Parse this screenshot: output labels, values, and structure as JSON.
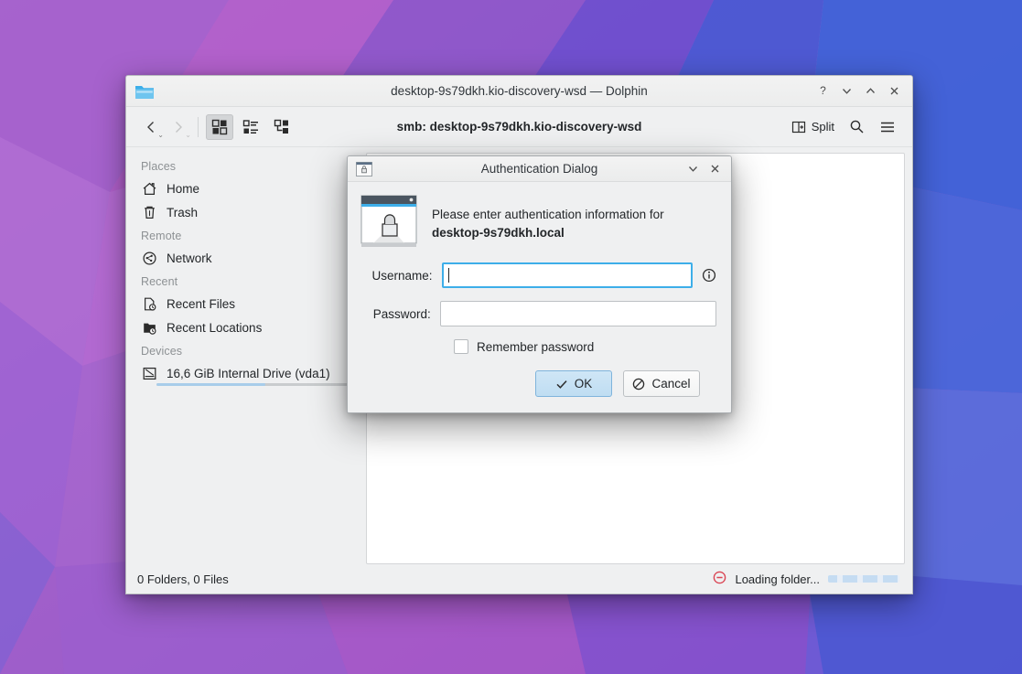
{
  "desktop": {
    "wallpaper_name": "plasma-polygon-wallpaper"
  },
  "window": {
    "title": "desktop-9s79dkh.kio-discovery-wsd — Dolphin",
    "app_icon": "folder-icon",
    "controls": [
      {
        "name": "help-button",
        "glyph": "?"
      },
      {
        "name": "minimize-button",
        "glyph": "⌄"
      },
      {
        "name": "maximize-button",
        "glyph": "⌃"
      },
      {
        "name": "close-button",
        "glyph": "✕"
      }
    ]
  },
  "toolbar": {
    "back_label": "Back",
    "forward_label": "Forward",
    "view_icons_label": "Icons",
    "view_compact_label": "Compact",
    "view_details_label": "Details",
    "url": "smb: desktop-9s79dkh.kio-discovery-wsd",
    "split_label": "Split",
    "search_label": "Search",
    "menu_label": "Menu"
  },
  "sidebar": {
    "groups": [
      {
        "title": "Places",
        "items": [
          {
            "label": "Home",
            "icon": "home-icon"
          },
          {
            "label": "Trash",
            "icon": "trash-icon"
          }
        ]
      },
      {
        "title": "Remote",
        "items": [
          {
            "label": "Network",
            "icon": "network-icon"
          }
        ]
      },
      {
        "title": "Recent",
        "items": [
          {
            "label": "Recent Files",
            "icon": "recent-file-icon"
          },
          {
            "label": "Recent Locations",
            "icon": "recent-folder-icon"
          }
        ]
      },
      {
        "title": "Devices",
        "items": [
          {
            "label": "16,6 GiB Internal Drive (vda1)",
            "icon": "harddisk-icon",
            "capacity_percent": 55
          }
        ]
      }
    ]
  },
  "statusbar": {
    "counts": "0 Folders, 0 Files",
    "stop_icon": "stop-loading-icon",
    "progress_text": "Loading folder...",
    "progress_indeterminate": true
  },
  "dialog": {
    "titlebar": {
      "icon": "lock-window-icon",
      "title": "Authentication Dialog",
      "controls": [
        {
          "name": "dialog-minimize-button",
          "glyph": "⌄"
        },
        {
          "name": "dialog-close-button",
          "glyph": "✕"
        }
      ]
    },
    "illustration_icon": "dialog-password-icon",
    "message_line1": "Please enter authentication information for",
    "message_host": "desktop-9s79dkh.local",
    "username": {
      "label": "Username:",
      "value": "",
      "placeholder": "",
      "focused": true,
      "info_icon": "info-icon"
    },
    "password": {
      "label": "Password:",
      "value": "",
      "placeholder": ""
    },
    "remember": {
      "label": "Remember password",
      "checked": false
    },
    "buttons": {
      "ok": "OK",
      "cancel": "Cancel"
    }
  },
  "colors": {
    "accent": "#3daee9",
    "window_bg": "#eff0f1",
    "text": "#232629",
    "muted_text": "#8d9194",
    "stop_red": "#da4453"
  }
}
